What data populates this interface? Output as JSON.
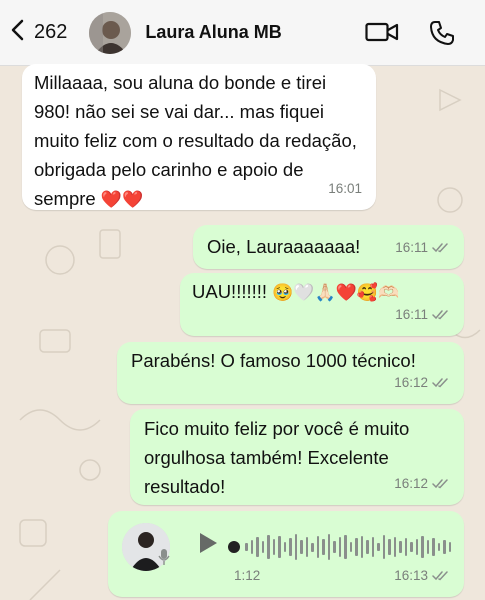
{
  "header": {
    "back_count": "262",
    "contact_name": "Laura Aluna MB"
  },
  "messages": [
    {
      "direction": "in",
      "text": "Millaaaa, sou aluna do bonde e tirei 980! não sei se vai dar... mas fiquei muito feliz com o resultado da redação, obrigada pelo carinho e apoio de sempre",
      "emoji": "❤️❤️",
      "time": "16:01"
    },
    {
      "direction": "out",
      "text": "Oie, Lauraaaaaaa!",
      "time": "16:11"
    },
    {
      "direction": "out",
      "text": "UAU!!!!!!!",
      "emoji": "🥹🤍🙏🏻❤️🥰🫶🏻",
      "time": "16:11"
    },
    {
      "direction": "out",
      "text": "Parabéns! O famoso 1000 técnico!",
      "time": "16:12"
    },
    {
      "direction": "out",
      "text": "Fico muito feliz por você é muito orgulhosa também! Excelente resultado!",
      "time": "16:12"
    },
    {
      "direction": "out",
      "type": "audio",
      "duration": "1:12",
      "time": "16:13"
    }
  ],
  "icons": {
    "back": "chevron-left-icon",
    "video": "video-camera-icon",
    "call": "phone-icon",
    "read": "double-check-icon",
    "play": "play-icon",
    "mic": "microphone-icon"
  },
  "colors": {
    "incoming_bubble": "#ffffff",
    "outgoing_bubble": "#d9fdd3",
    "chat_background": "#efe7dc",
    "read_ticks": "#8a8f8c"
  }
}
